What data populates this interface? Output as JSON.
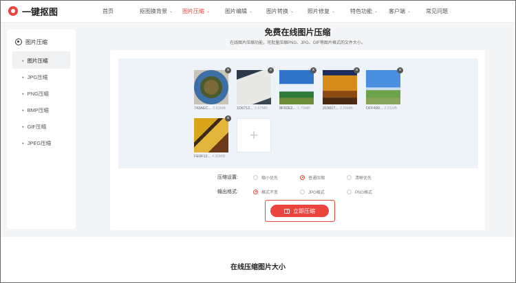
{
  "header": {
    "logo_text": "一键抠图",
    "nav": [
      {
        "label": "首页",
        "chevron": false,
        "active": false
      },
      {
        "label": "抠图换背景",
        "chevron": true,
        "active": false
      },
      {
        "label": "图片压缩",
        "chevron": true,
        "active": true
      },
      {
        "label": "图片编辑",
        "chevron": true,
        "active": false
      },
      {
        "label": "图片转换",
        "chevron": true,
        "active": false
      },
      {
        "label": "照片修复",
        "chevron": true,
        "active": false
      },
      {
        "label": "特色功能",
        "chevron": true,
        "active": false
      },
      {
        "label": "客户端",
        "chevron": true,
        "active": false
      },
      {
        "label": "常见问题",
        "chevron": false,
        "active": false
      }
    ]
  },
  "sidebar": {
    "title": "图片压缩",
    "items": [
      {
        "label": "图片压缩",
        "active": true
      },
      {
        "label": "JPG压缩",
        "active": false
      },
      {
        "label": "PNG压缩",
        "active": false
      },
      {
        "label": "BMP压缩",
        "active": false
      },
      {
        "label": "GIF压缩",
        "active": false
      },
      {
        "label": "JPEG压缩",
        "active": false
      }
    ]
  },
  "main": {
    "title": "免费在线图片压缩",
    "subtitle": "在线图片压缩功能，可批量压缩PNG、JPG、GIF等图片格式的文件大小。",
    "files": [
      {
        "name": "743AEC...",
        "size": "2.63MB",
        "theme": "food"
      },
      {
        "name": "1D6712...",
        "size": "2.67MB",
        "theme": "screen"
      },
      {
        "name": "8F92E2...",
        "size": "1.70MB",
        "theme": "sky"
      },
      {
        "name": "219817...",
        "size": "2.26MB",
        "theme": "autumn"
      },
      {
        "name": "DFF490...",
        "size": "2.21MB",
        "theme": "field"
      },
      {
        "name": "FE0F12...",
        "size": "4.30MB",
        "theme": "leaves"
      }
    ],
    "add_icon": "plus-icon",
    "compress_setting": {
      "label": "压缩设置:",
      "options": [
        {
          "label": "缩小优先",
          "selected": false
        },
        {
          "label": "普通压缩",
          "selected": true
        },
        {
          "label": "清晰优先",
          "selected": false
        }
      ]
    },
    "output_format": {
      "label": "输出格式:",
      "options": [
        {
          "label": "格式不变",
          "selected": true
        },
        {
          "label": "JPG格式",
          "selected": false
        },
        {
          "label": "PNG格式",
          "selected": false
        }
      ]
    },
    "button_label": "立即压缩"
  },
  "section_title": "在线压缩图片大小",
  "colors": {
    "accent": "#e9443e",
    "band": "#f4f5f7",
    "upload_bg": "#eef2f9"
  }
}
